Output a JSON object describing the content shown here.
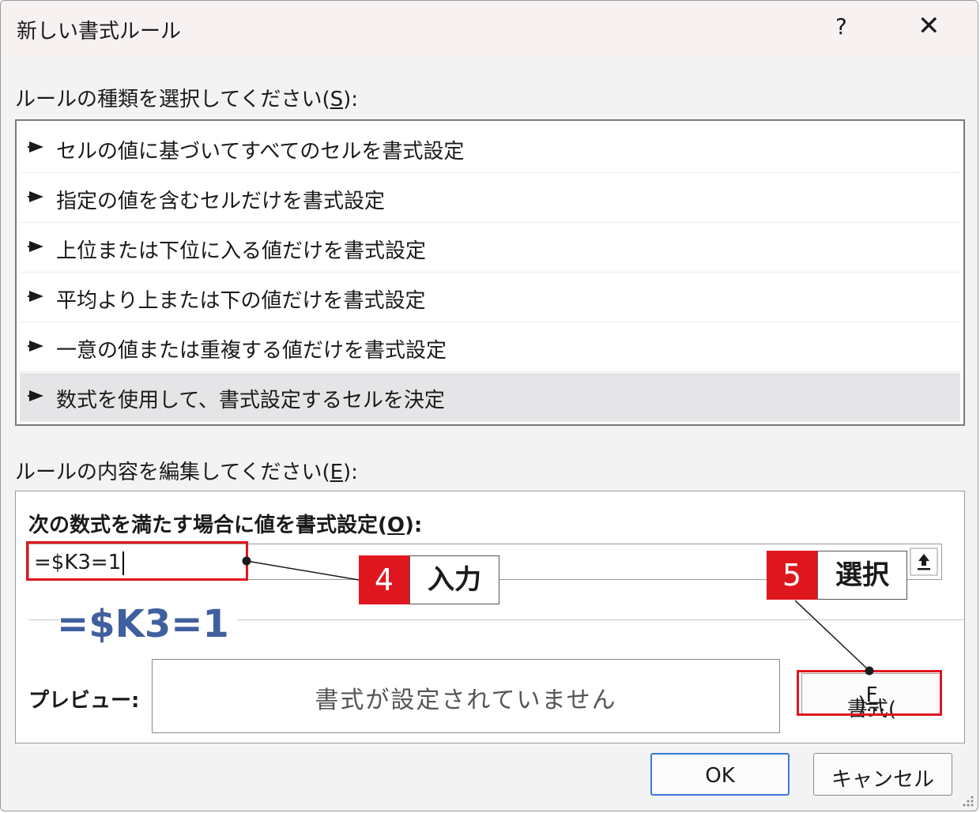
{
  "dialog": {
    "title": "新しい書式ルール",
    "help_label": "?",
    "close_label": "✕"
  },
  "rule_type": {
    "label_prefix": "ルールの種類を選択してください(",
    "label_key": "S",
    "label_suffix": "):",
    "items": [
      {
        "label": "セルの値に基づいてすべてのセルを書式設定"
      },
      {
        "label": "指定の値を含むセルだけを書式設定"
      },
      {
        "label": "上位または下位に入る値だけを書式設定"
      },
      {
        "label": "平均より上または下の値だけを書式設定"
      },
      {
        "label": "一意の値または重複する値だけを書式設定"
      },
      {
        "label": "数式を使用して、書式設定するセルを決定"
      }
    ],
    "selected_index": 5
  },
  "rule_edit": {
    "label_prefix": "ルールの内容を編集してください(",
    "label_key": "E",
    "label_suffix": "):",
    "formula_label_prefix": "次の数式を満たす場合に値を書式設定(",
    "formula_label_key": "O",
    "formula_label_suffix": "):",
    "formula_value": "=$K3=1",
    "big_formula": "=$K3=1",
    "preview_label": "プレビュー:",
    "preview_text": "書式が設定されていません",
    "format_button_prefix": "書式(",
    "format_button_key": "F",
    "format_button_suffix": ")..."
  },
  "buttons": {
    "ok": "OK",
    "cancel": "キャンセル"
  },
  "callouts": [
    {
      "number": "4",
      "text": "入力"
    },
    {
      "number": "5",
      "text": "選択"
    }
  ],
  "colors": {
    "highlight_red": "#e0161f",
    "formula_blue": "#3f5f9f",
    "selected_row": "#e5e5e8",
    "ok_border": "#3a78d6"
  },
  "icons": {
    "collapse": "collapse-dialog-icon",
    "rule_marker": "triangle-arrow-icon"
  }
}
